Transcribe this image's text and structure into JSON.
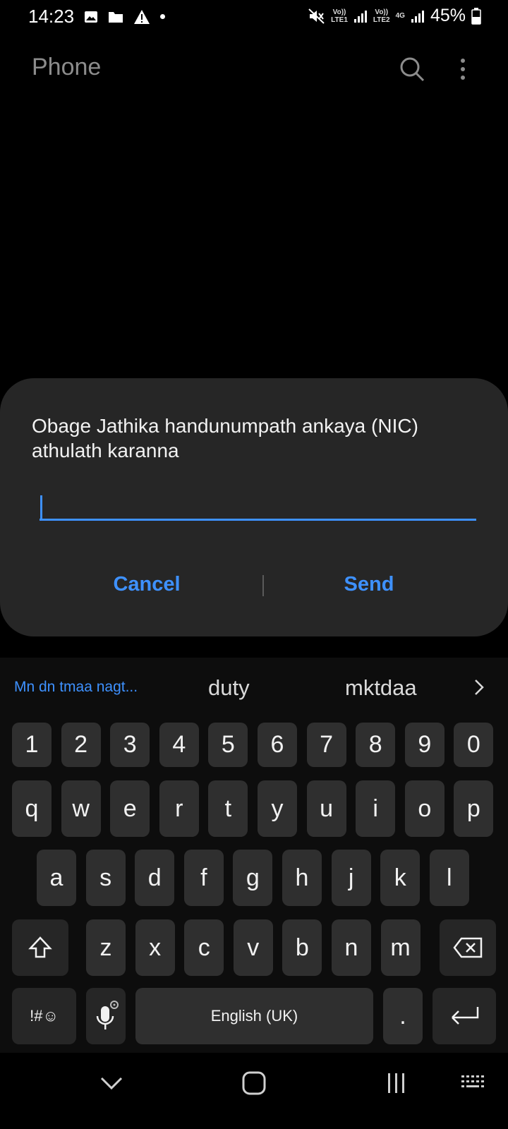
{
  "status_bar": {
    "time": "14:23",
    "left_icons": [
      "image-icon",
      "folder-icon",
      "warning-icon",
      "dot-icon"
    ],
    "sim1_label_top": "Vo))",
    "sim1_label_bottom": "LTE1",
    "sim2_label_top": "Vo))",
    "sim2_label_bottom": "LTE2",
    "network_type": "4G",
    "battery_percent": "45%",
    "battery_level": 0.45
  },
  "app_bar": {
    "title": "Phone",
    "icons": [
      "search-icon",
      "more-vert-icon"
    ]
  },
  "dialog": {
    "message": "Obage Jathika handunumpath ankaya (NIC) athulath karanna",
    "input_value": "",
    "cancel_label": "Cancel",
    "send_label": "Send",
    "accent_color": "#3e91ff"
  },
  "keyboard": {
    "suggestions": [
      "Mn dn tmaa nagt...",
      "duty",
      "mktdaa"
    ],
    "number_row": [
      "1",
      "2",
      "3",
      "4",
      "5",
      "6",
      "7",
      "8",
      "9",
      "0"
    ],
    "row1": [
      "q",
      "w",
      "e",
      "r",
      "t",
      "y",
      "u",
      "i",
      "o",
      "p"
    ],
    "row2": [
      "a",
      "s",
      "d",
      "f",
      "g",
      "h",
      "j",
      "k",
      "l"
    ],
    "row3": [
      "z",
      "x",
      "c",
      "v",
      "b",
      "n",
      "m"
    ],
    "symbols_label": "!#☺",
    "space_label": "English (UK)",
    "period_label": "."
  },
  "nav_bar": {
    "icons": [
      "hide-keyboard-icon",
      "home-icon",
      "recents-icon",
      "keyboard-icon"
    ]
  }
}
